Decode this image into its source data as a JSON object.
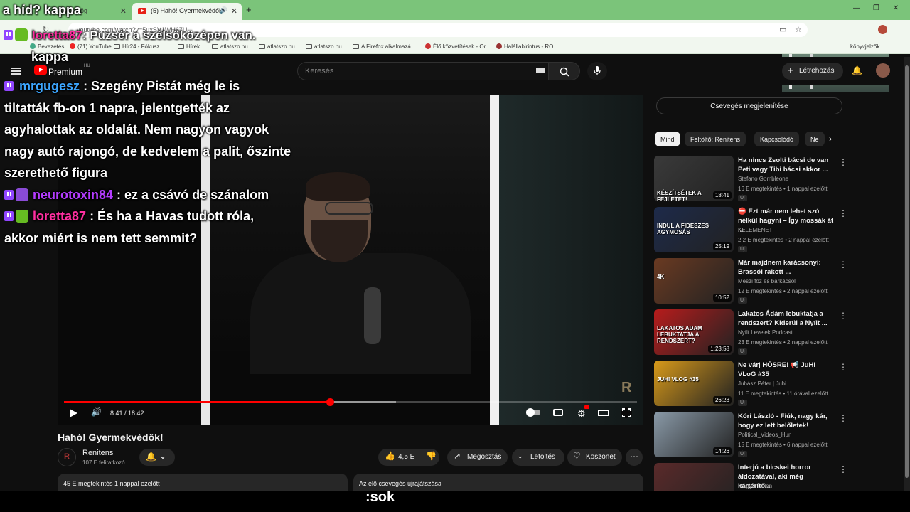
{
  "browser": {
    "tabs": [
      {
        "label": "ioga mög"
      },
      {
        "label": "(5) Hahó! Gyermekvédők! -"
      }
    ],
    "url": "youtube.com/watch?v=5uxSV1WH67U",
    "bookmarks": [
      "Bevezetés",
      "(71) YouTube",
      "Hír24 - Fókusz",
      "Hírek",
      "atlatszo.hu",
      "atlatszo.hu",
      "atlatszo.hu",
      "A Firefox alkalmazá...",
      "Élő közvetítések - Or...",
      "Halállabirintus - RO..."
    ],
    "bookmarks_right": "könyvjelzők"
  },
  "youtube": {
    "brand": "Premium",
    "region": "HU",
    "search_placeholder": "Keresés",
    "create_label": "Létrehozás"
  },
  "player": {
    "current_time": "8:41",
    "duration": "18:42",
    "time_label": "8:41 / 18:42",
    "played_fraction": 0.464,
    "buffered_fraction": 0.58,
    "watermark": "R"
  },
  "video": {
    "title": "Hahó! Gyermekvédők!",
    "channel": "Renitens",
    "subscribers": "107 E feliratkozó",
    "likes": "4,5 E",
    "share_label": "Megosztás",
    "download_label": "Letöltés",
    "thanks_label": "Köszönet",
    "description": "45 E megtekintés  1 nappal ezelőtt",
    "chat_replay": "Az élő csevegés újrajátszása"
  },
  "sidebar": {
    "show_chat": "Csevegés megjelenítése",
    "chips": [
      "Mind",
      "Feltöltő: Renitens",
      "Kapcsolódó",
      "Ne"
    ],
    "recommendations": [
      {
        "title": "Ha nincs Zsolti bácsi de van Peti vagy Tibi bácsi akkor ...",
        "channel": "Stefano Gombleone",
        "meta": "16 E megtekintés • 1 nappal ezelőtt",
        "badge": "Új",
        "duration": "18:41",
        "thumb_text": "KÉSZÍTSÉTEK A FEJLETET!",
        "color": "#3a3a3a"
      },
      {
        "title": "⛔ Ezt már nem lehet szó nélkül hagyni – Így mossák át ...",
        "channel": "KELEMENET",
        "meta": "2,2 E megtekintés • 2 nappal ezelőtt",
        "badge": "Új",
        "duration": "25:19",
        "thumb_text": "INDUL A FIDESZES AGYMOSÁS",
        "color": "#1d2a4a"
      },
      {
        "title": "Már majdnem karácsonyi: Brassói rakott ...",
        "channel": "Mészi főz és barkácsol",
        "meta": "12 E megtekintés • 2 nappal ezelőtt",
        "badge": "Új",
        "duration": "10:52",
        "thumb_text": "4K",
        "color": "#6a3a22"
      },
      {
        "title": "Lakatos Ádám lebuktatja a rendszert? Kiderül a Nyílt ...",
        "channel": "Nyílt Levelek Podcast",
        "meta": "23 E megtekintés • 2 nappal ezelőtt",
        "badge": "Új",
        "duration": "1:23:58",
        "thumb_text": "LAKATOS ADAM LEBUKTATJA A RENDSZERT?",
        "color": "#b71c1c"
      },
      {
        "title": "Ne várj HŐSRE! 📢 JuHi VLoG #35",
        "channel": "Juhász Péter | Juhi",
        "meta": "11 E megtekintés • 11 órával ezelőtt",
        "badge": "Új",
        "duration": "26:28",
        "thumb_text": "JUHI VLOG #35",
        "color": "#d89a1a"
      },
      {
        "title": "Kóri László - Fiúk, nagy kár, hogy ez lett belőletek!",
        "channel": "Political_Videos_Hun",
        "meta": "15 E megtekintés • 6 nappal ezelőtt",
        "badge": "Új",
        "duration": "14:26",
        "thumb_text": "",
        "color": "#8a9aa8"
      },
      {
        "title": "Interjú a bicskei horror áldozatával, aki még kártérítő...",
        "channel": "Magyar Jelen",
        "meta": "",
        "badge": "",
        "duration": "",
        "thumb_text": "",
        "color": "#5a2a2a"
      }
    ]
  },
  "overlay": {
    "top_line": "a híd? kappa",
    "line1_user": "loretta87",
    "line1_text": ": Puzsér a szélsőközépen van.",
    "line2_text": "kappa",
    "msg1_user": "mrgugesz",
    "msg1_lines": [
      ": Szegény Pistát még le is",
      "tiltatták fb-on 1 napra, jelentgették az",
      "agyhalottak az oldalát. Nem nagyon vagyok",
      "nagy autó rajongó, de kedvelem a palit, őszinte",
      "szerethető figura"
    ],
    "msg2_user": "neurotoxin84",
    "msg2_text": ": ez a csávó de szánalom",
    "msg3_user": "loretta87",
    "msg3_lines": [
      ": És ha a Havas tudott róla,",
      "akkor miért is nem tett semmit?"
    ],
    "caption": ":sok",
    "colors": {
      "loretta": "#ff2fa0",
      "mrgugesz": "#3da6ff",
      "neurotoxin": "#b43cff",
      "twitch": "#9146ff"
    }
  }
}
